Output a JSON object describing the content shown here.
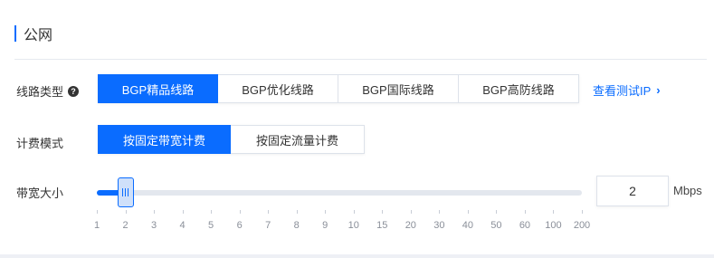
{
  "section": {
    "title": "公网"
  },
  "line_type": {
    "label": "线路类型",
    "help_icon": "help-icon",
    "options": [
      "BGP精品线路",
      "BGP优化线路",
      "BGP国际线路",
      "BGP高防线路"
    ],
    "selected_index": 0,
    "test_ip_link": "查看测试IP",
    "link_icon": "chevron-right-icon"
  },
  "billing": {
    "label": "计费模式",
    "options": [
      "按固定带宽计费",
      "按固定流量计费"
    ],
    "selected_index": 0
  },
  "bandwidth": {
    "label": "带宽大小",
    "ticks": [
      "1",
      "2",
      "3",
      "4",
      "5",
      "6",
      "7",
      "8",
      "9",
      "10",
      "15",
      "20",
      "30",
      "40",
      "50",
      "60",
      "100",
      "200"
    ],
    "selected_tick_index": 1,
    "value": "2",
    "unit": "Mbps"
  },
  "colors": {
    "accent": "#0a6cff",
    "track": "#e3e7ee",
    "handle_fill": "#cfe0fa"
  }
}
